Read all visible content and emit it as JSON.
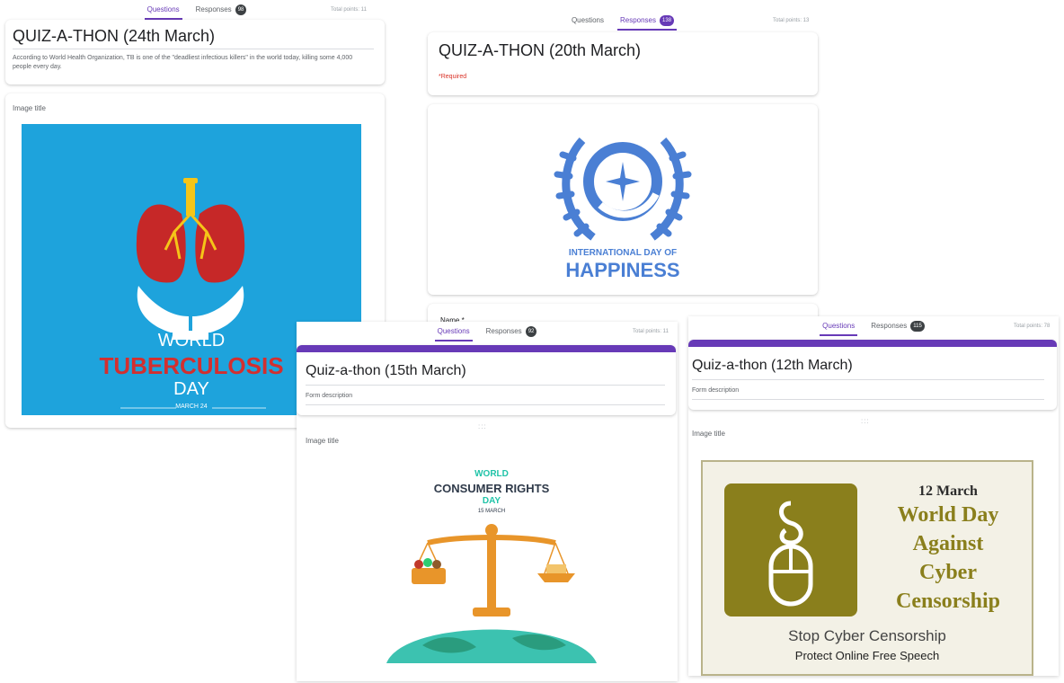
{
  "shot1": {
    "tabs": {
      "questions": "Questions",
      "responses": "Responses",
      "responses_count": "98"
    },
    "total_points": "Total points: 11",
    "title": "QUIZ-A-THON (24th March)",
    "description": "According to World Health Organization, TB is one of the \"deadliest infectious killers\" in the world today, killing some 4,000 people every day.",
    "image_title": "Image title",
    "poster": {
      "line1": "WORLD",
      "line2": "TUBERCULOSIS",
      "line3": "DAY",
      "date": "MARCH 24"
    }
  },
  "shot2": {
    "tabs": {
      "questions": "Questions",
      "responses": "Responses",
      "responses_count": "138"
    },
    "total_points": "Total points: 13",
    "title": "QUIZ-A-THON (20th March)",
    "required": "*Required",
    "logo": {
      "line1": "INTERNATIONAL DAY OF",
      "line2": "HAPPINESS"
    },
    "next_field": "Name *"
  },
  "shot3": {
    "tabs": {
      "questions": "Questions",
      "responses": "Responses",
      "responses_count": "92"
    },
    "total_points": "Total points: 11",
    "title": "Quiz-a-thon (15th March)",
    "description": "Form description",
    "drag_handle": ":::",
    "image_title": "Image title",
    "poster": {
      "line1": "WORLD",
      "line2": "CONSUMER RIGHTS",
      "line3": "DAY",
      "date": "15 MARCH"
    }
  },
  "shot4": {
    "tabs": {
      "questions": "Questions",
      "responses": "Responses",
      "responses_count": "115"
    },
    "total_points": "Total points: 78",
    "title": "Quiz-a-thon (12th March)",
    "description": "Form description",
    "drag_handle": ":::",
    "image_title": "Image title",
    "poster": {
      "date": "12 March",
      "line1": "World Day",
      "line2": "Against",
      "line3": "Cyber",
      "line4": "Censorship",
      "tag1": "Stop Cyber Censorship",
      "tag2": "Protect Online  Free Speech"
    }
  },
  "colors": {
    "accent": "#673ab7",
    "tb_bg": "#1ea3dc",
    "tb_red": "#d32f2f",
    "un_blue": "#4a7fd4",
    "olive": "#8a7f1c"
  }
}
